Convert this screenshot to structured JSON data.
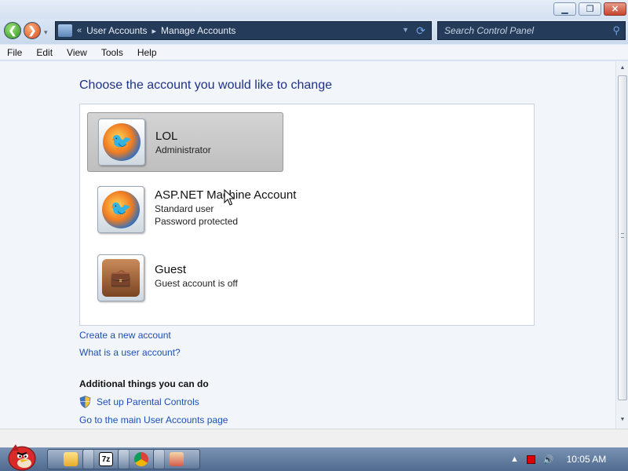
{
  "window": {
    "minimize_icon": "minimize-icon",
    "maximize_icon": "restore-icon",
    "close_icon": "close-icon"
  },
  "navbar": {
    "breadcrumb_prefix": "«",
    "breadcrumb": [
      "User Accounts",
      "Manage Accounts"
    ],
    "search_placeholder": "Search Control Panel"
  },
  "menu": [
    "File",
    "Edit",
    "View",
    "Tools",
    "Help"
  ],
  "main": {
    "heading": "Choose the account you would like to change",
    "accounts": [
      {
        "name": "LOL",
        "lines": [
          "Administrator"
        ],
        "selected": true,
        "icon": "user-avatar-icon"
      },
      {
        "name": "ASP.NET Machine Account",
        "lines": [
          "Standard user",
          "Password protected"
        ],
        "selected": false,
        "icon": "user-avatar-icon"
      },
      {
        "name": "Guest",
        "lines": [
          "Guest account is off"
        ],
        "selected": false,
        "icon": "guest-briefcase-icon"
      }
    ],
    "links": {
      "create_account": "Create a new account",
      "what_is_account": "What is a user account?"
    },
    "additional_title": "Additional things you can do",
    "parental_controls": "Set up Parental Controls",
    "main_accounts_page": "Go to the main User Accounts page"
  },
  "taskbar": {
    "buttons": [
      "folder-icon",
      "7zip-icon",
      "chrome-icon",
      "app-icon"
    ],
    "seven_zip_label": "7z",
    "clock": "10:05 AM"
  },
  "colors": {
    "heading": "#1e3287",
    "link": "#1c4fb5",
    "address_bg": "#243b5a"
  }
}
